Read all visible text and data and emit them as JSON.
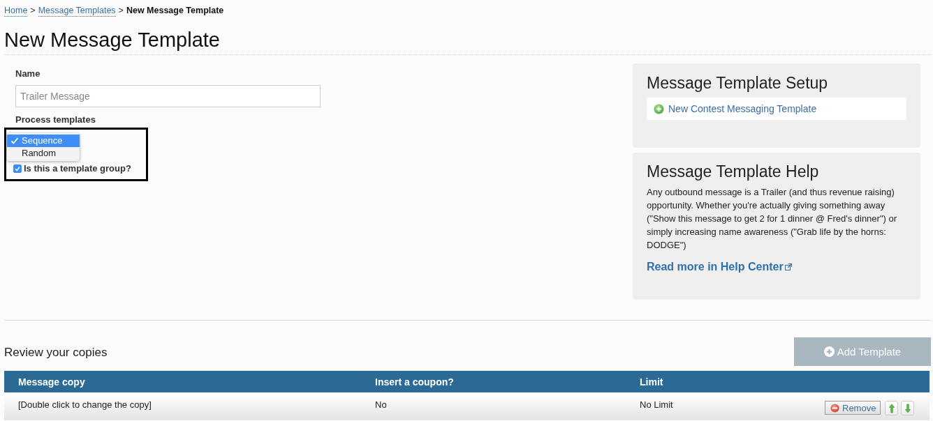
{
  "breadcrumb": [
    {
      "kind": "link",
      "label": "Home"
    },
    {
      "kind": "separator",
      "label": ">"
    },
    {
      "kind": "link",
      "label": "Message Templates"
    },
    {
      "kind": "separator",
      "label": ">"
    },
    {
      "kind": "current",
      "label": "New Message Template"
    }
  ],
  "page_title": "New Message Template",
  "form": {
    "name_field": {
      "label": "Name",
      "placeholder": "Trailer Message"
    },
    "process_templates": {
      "label": "Process templates",
      "highlighted": true,
      "expanded": true,
      "options": [
        {
          "label": "Sequence",
          "selected": true
        },
        {
          "label": "Random",
          "selected": false
        }
      ]
    },
    "template_group": {
      "label": "Is this a template group?",
      "checked": true
    }
  },
  "setup_panel": {
    "title": "Message Template Setup",
    "links": [
      {
        "label": "New Contest Messaging Template"
      }
    ]
  },
  "help_panel": {
    "title": "Message Template Help",
    "text": "Any outbound message is a Trailer (and thus revenue raising) opportunity. Whether you're actually giving something away (\"Show this message to get 2 for 1 dinner @ Fred's dinner\") or simply increasing name awareness (\"Grab life by the horns: DODGE\")",
    "link": "Read more in Help Center"
  },
  "review": {
    "title": "Review your copies",
    "add_button": {
      "label": "Add Template",
      "disabled": true
    },
    "table": {
      "columns": [
        "Message copy",
        "Insert a coupon?",
        "Limit"
      ],
      "rows": [
        {
          "cells": [
            "[Double click to change the copy]",
            "No",
            "No Limit"
          ],
          "actions": [
            {
              "kind": "remove",
              "label": "Remove"
            },
            {
              "kind": "move_up"
            },
            {
              "kind": "move_down"
            }
          ]
        }
      ]
    }
  }
}
